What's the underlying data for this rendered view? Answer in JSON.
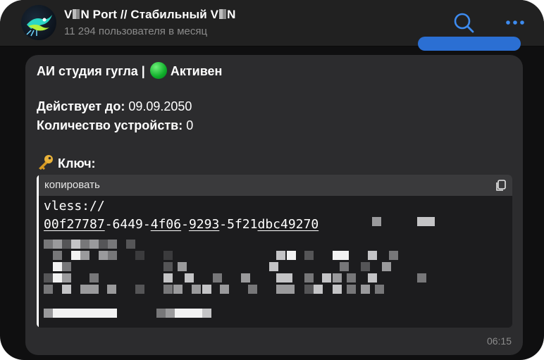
{
  "header": {
    "title_start": "V",
    "title_mid": "N Port // Стабильный V",
    "title_end": "N",
    "subtitle": "11 294 пользователя в месяц"
  },
  "message": {
    "line1_text": "АИ студия гугла |",
    "status_label": "Активен",
    "valid_label": "Действует до:",
    "valid_value": "09.09.2050",
    "devices_label": "Количество устройств:",
    "devices_value": "0",
    "key_label": "Ключ:",
    "code_header": "копировать",
    "code_line1": "vless://",
    "uuid_parts": [
      "00f27787",
      "-6449-",
      "4f06",
      "-",
      "9293",
      "-5f21",
      "dbc",
      "49270"
    ],
    "time": "06:15"
  },
  "colors": {
    "accent_blue": "#3d8bef",
    "status_green": "#1fc23a",
    "key_gold": "#e9b23a"
  },
  "icons": [
    "search-icon",
    "more-icon",
    "key-icon",
    "copy-icon",
    "status-dot-icon"
  ]
}
